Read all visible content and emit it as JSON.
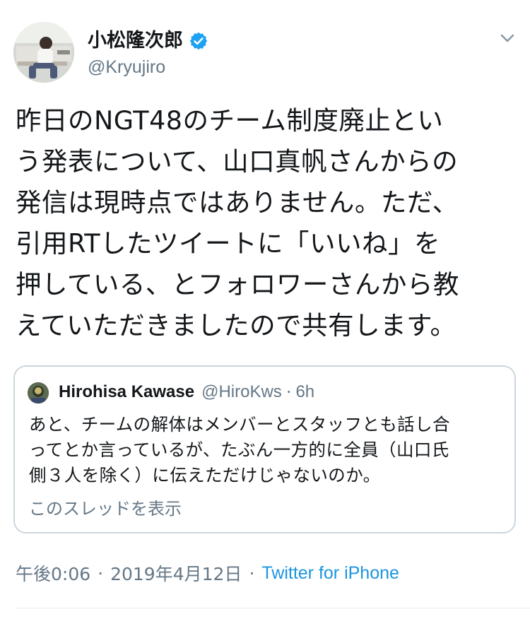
{
  "author": {
    "display_name": "小松隆次郎",
    "handle": "@Kryujiro",
    "verified": true,
    "avatar_icon": "profile-photo"
  },
  "tweet": {
    "text": "昨日のNGT48のチーム制度廃止とい\nう発表について、山口真帆さんからの\n発信は現時点ではありません。ただ、\n引用RTしたツイートに「いいね」を\n押している、とフォロワーさんから教\nえていただきましたので共有します。"
  },
  "quoted_tweet": {
    "name": "Hirohisa Kawase",
    "handle": "@HiroKws",
    "dot": "·",
    "time": "6h",
    "text": "あと、チームの解体はメンバーとスタッフとも話し合\nってとか言っているが、たぶん一方的に全員（山口氏\n側３人を除く）に伝えただけじゃないのか。",
    "show_thread_label": "このスレッドを表示"
  },
  "meta": {
    "time": "午後0:06",
    "sep1": "·",
    "date": "2019年4月12日",
    "sep2": "·",
    "source": "Twitter for iPhone"
  },
  "colors": {
    "accent": "#1b95e0",
    "verified": "#1da1f2",
    "secondary_text": "#657786",
    "border": "#ccd6dd"
  }
}
